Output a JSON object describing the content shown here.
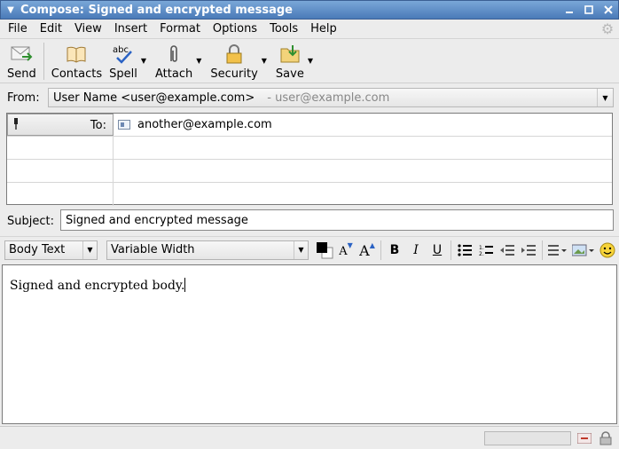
{
  "window": {
    "title": "Compose: Signed and encrypted message"
  },
  "menu": [
    {
      "label": "File"
    },
    {
      "label": "Edit"
    },
    {
      "label": "View"
    },
    {
      "label": "Insert"
    },
    {
      "label": "Format"
    },
    {
      "label": "Options"
    },
    {
      "label": "Tools"
    },
    {
      "label": "Help"
    }
  ],
  "toolbar": {
    "send": "Send",
    "contacts": "Contacts",
    "spell": "Spell",
    "attach": "Attach",
    "security": "Security",
    "save": "Save"
  },
  "from": {
    "label": "From:",
    "identity": "User Name <user@example.com>",
    "secondary": "- user@example.com"
  },
  "recipients": [
    {
      "type": "To:",
      "address": "another@example.com"
    },
    {
      "type": "",
      "address": ""
    },
    {
      "type": "",
      "address": ""
    },
    {
      "type": "",
      "address": ""
    }
  ],
  "subject": {
    "label": "Subject:",
    "value": "Signed and encrypted message"
  },
  "format": {
    "paragraph_style": "Body Text",
    "font": "Variable Width",
    "text_color": "#000000"
  },
  "body": {
    "text": "Signed and encrypted body."
  }
}
